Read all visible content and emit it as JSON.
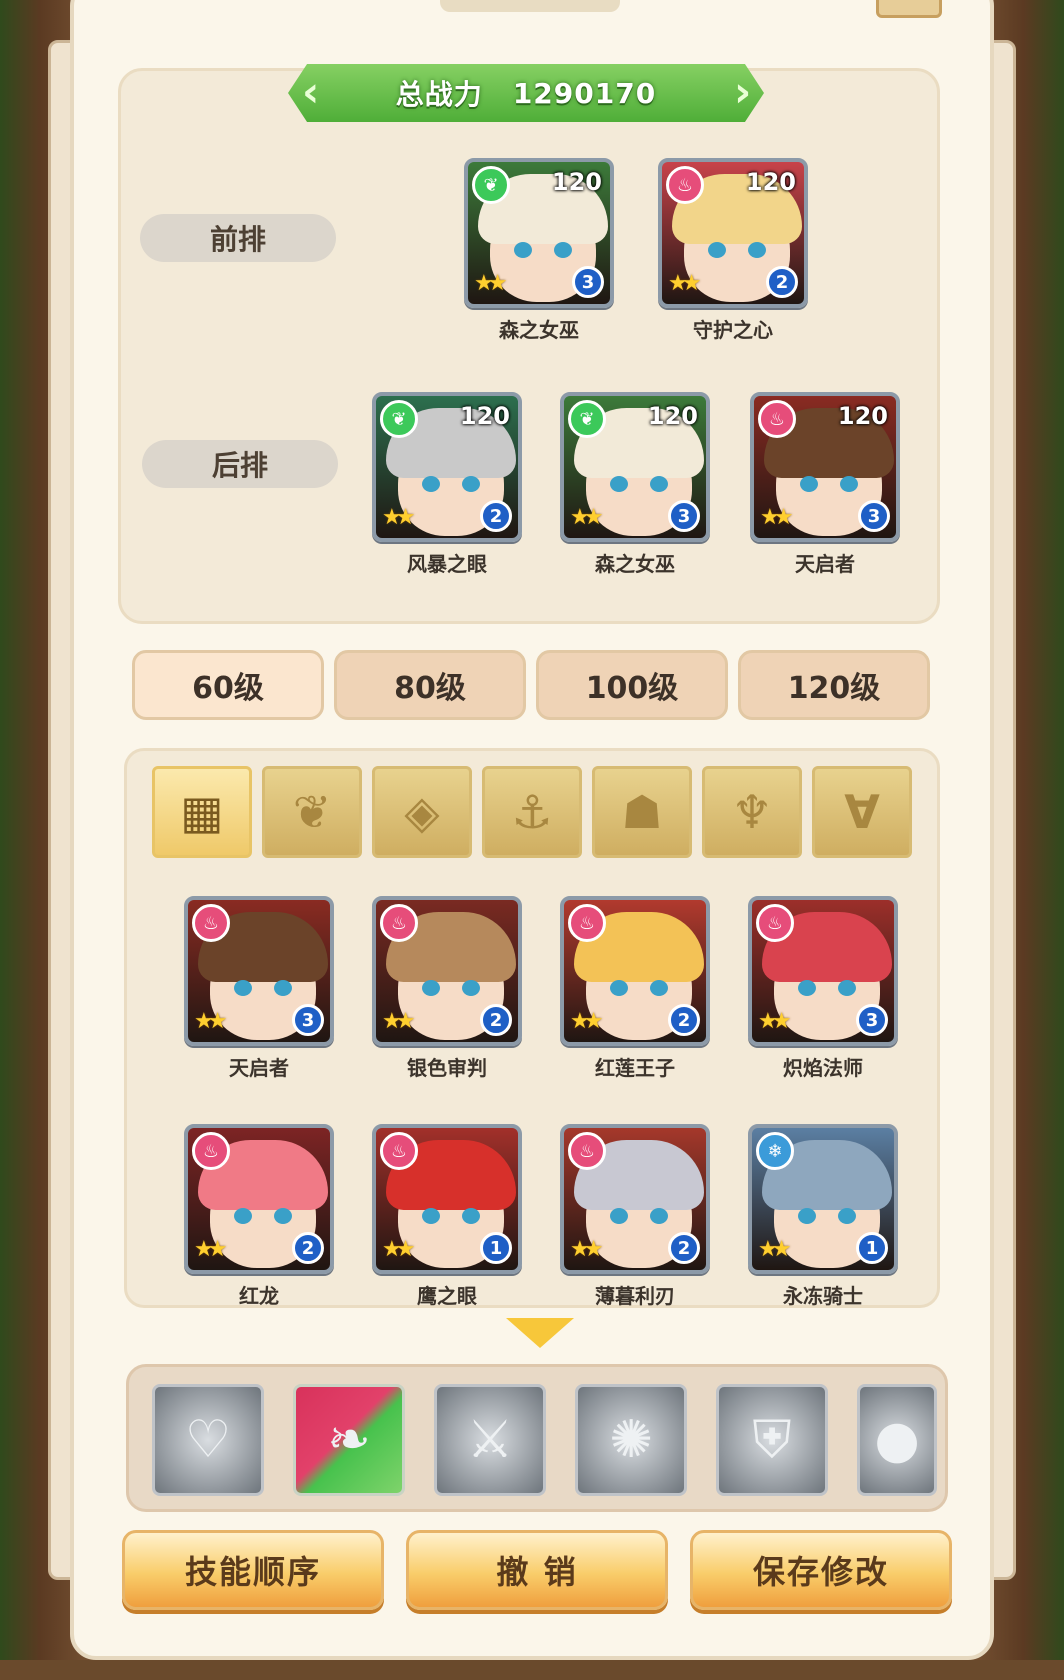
{
  "total_power": {
    "label": "总战力",
    "value": "1290170"
  },
  "rows": {
    "front": "前排",
    "back": "后排"
  },
  "front_heroes": [
    {
      "name": "森之女巫",
      "level": "120",
      "rank": "3",
      "element": "nature",
      "elem_color": "#3cc95a",
      "hair": "#f2ead8",
      "bg": "#3c7a3a"
    },
    {
      "name": "守护之心",
      "level": "120",
      "rank": "2",
      "element": "fire",
      "elem_color": "#e64d7a",
      "hair": "#f2d58a",
      "bg": "#c8434a"
    }
  ],
  "back_heroes": [
    {
      "name": "风暴之眼",
      "level": "120",
      "rank": "2",
      "element": "nature",
      "elem_color": "#3cc95a",
      "hair": "#c9c9c9",
      "bg": "#2c6f4e"
    },
    {
      "name": "森之女巫",
      "level": "120",
      "rank": "3",
      "element": "nature",
      "elem_color": "#3cc95a",
      "hair": "#f2ead8",
      "bg": "#3c7a3a"
    },
    {
      "name": "天启者",
      "level": "120",
      "rank": "3",
      "element": "fire",
      "elem_color": "#e64d7a",
      "hair": "#6b4329",
      "bg": "#8a2b22"
    }
  ],
  "level_tabs": [
    {
      "label": "60级",
      "active": true
    },
    {
      "label": "80级",
      "active": false
    },
    {
      "label": "100级",
      "active": false
    },
    {
      "label": "120级",
      "active": false
    }
  ],
  "filter_tabs": [
    {
      "icon": "grid-icon",
      "glyph": "▦",
      "active": true
    },
    {
      "icon": "leaf-icon",
      "glyph": "❦",
      "active": false
    },
    {
      "icon": "diamond-icon",
      "glyph": "◈",
      "active": false
    },
    {
      "icon": "anchor-icon",
      "glyph": "⚓",
      "active": false
    },
    {
      "icon": "beast-head-icon",
      "glyph": "☗",
      "active": false
    },
    {
      "icon": "demon-horns-icon",
      "glyph": "♆",
      "active": false
    },
    {
      "icon": "wings-v-icon",
      "glyph": "∀",
      "active": false
    }
  ],
  "roster": [
    {
      "name": "天启者",
      "rank": "3",
      "element": "fire",
      "elem_color": "#e64d7a",
      "hair": "#6b4329",
      "bg": "#8a2b22"
    },
    {
      "name": "银色审判",
      "rank": "2",
      "element": "fire",
      "elem_color": "#e64d7a",
      "hair": "#b6895c",
      "bg": "#7a2a22"
    },
    {
      "name": "红莲王子",
      "rank": "2",
      "element": "fire",
      "elem_color": "#e64d7a",
      "hair": "#f3c256",
      "bg": "#b23a2e"
    },
    {
      "name": "炽焰法师",
      "rank": "3",
      "element": "fire",
      "elem_color": "#e64d7a",
      "hair": "#d9434e",
      "bg": "#9c2f2a"
    },
    {
      "name": "红龙",
      "rank": "2",
      "element": "fire",
      "elem_color": "#e64d7a",
      "hair": "#f07a86",
      "bg": "#7d2424"
    },
    {
      "name": "鹰之眼",
      "rank": "1",
      "element": "fire",
      "elem_color": "#e64d7a",
      "hair": "#d7302b",
      "bg": "#a2302a"
    },
    {
      "name": "薄暮利刃",
      "rank": "2",
      "element": "fire",
      "elem_color": "#e64d7a",
      "hair": "#c8c8d2",
      "bg": "#a5382b"
    },
    {
      "name": "永冻骑士",
      "rank": "1",
      "element": "ice",
      "elem_color": "#3b9bd9",
      "hair": "#8ea7be",
      "bg": "#5b7fa3"
    }
  ],
  "skills": [
    {
      "icon": "heart-icon",
      "glyph": "♡",
      "colored": false
    },
    {
      "icon": "flame-leaf-icon",
      "glyph": "❧",
      "colored": true
    },
    {
      "icon": "winged-blade-icon",
      "glyph": "⚔",
      "colored": false
    },
    {
      "icon": "burst-icon",
      "glyph": "✺",
      "colored": false
    },
    {
      "icon": "shield-icon",
      "glyph": "⛨",
      "colored": false
    },
    {
      "icon": "orb-icon",
      "glyph": "●",
      "colored": false
    }
  ],
  "actions": {
    "skill_order": "技能顺序",
    "undo": "撤 销",
    "save": "保存修改"
  }
}
